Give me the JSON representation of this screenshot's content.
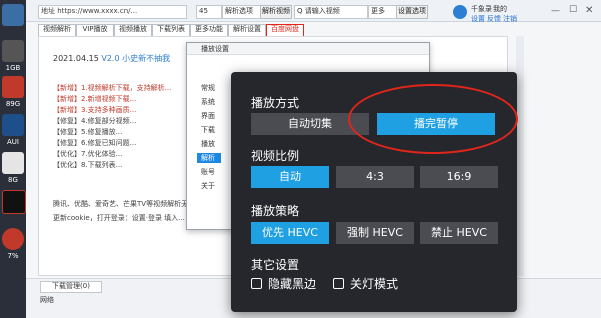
{
  "desktop": {
    "labels": [
      "1GB",
      "89G",
      "AUI",
      "8G",
      "7%"
    ]
  },
  "toolbar": {
    "url": "地址 https://www.xxxx.cn/...",
    "zoom": "45",
    "dropdown1": "解析选项",
    "button1": "解析视频",
    "search_placeholder": "Q 请输入视频",
    "select2": "更多",
    "button2": "设置选项"
  },
  "user": {
    "name": "千象录",
    "status": "我的",
    "links": [
      "设置",
      "反馈",
      "注销"
    ]
  },
  "tabs": [
    "视频解析",
    "VIP播放",
    "视频播放",
    "下载列表",
    "更多功能",
    "解析设置",
    "百度网盘"
  ],
  "doc": {
    "date_line": "2021.04.15",
    "version": "V2.0 小史新不抽我",
    "items": [
      "【新增】1.视频解析下载，支持解析...",
      "【新增】2.新增视频下载...",
      "【新增】3.支持多种画质...",
      "【修复】4.修复部分视频...",
      "【修复】5.修复播放...",
      "【修复】6.修复已知问题...",
      "【优化】7.优化体验...",
      "【优化】8.下载列表..."
    ],
    "line2": "腾讯、优酷、爱奇艺、芒果TV等视频解析无需登录...",
    "line3": "更新cookie，打开登录：设置·登录  填入..."
  },
  "dialog": {
    "title": "播放设置",
    "nav": [
      "常规",
      "系统",
      "界面",
      "下载",
      "播放",
      "解析",
      "账号",
      "关于"
    ],
    "selected": "播放"
  },
  "statusbar": {
    "downloads": "下载管理(0)",
    "net": "网络"
  },
  "panel": {
    "sections": [
      {
        "title": "播放方式",
        "options": [
          "自动切集",
          "播完暂停"
        ],
        "active": 1
      },
      {
        "title": "视频比例",
        "options": [
          "自动",
          "4:3",
          "16:9"
        ],
        "active": 0
      },
      {
        "title": "播放策略",
        "options": [
          "优先 HEVC",
          "强制 HEVC",
          "禁止 HEVC"
        ],
        "active": 0
      },
      {
        "title": "其它设置"
      }
    ],
    "checkboxes": [
      "隐藏黑边",
      "关灯模式"
    ]
  },
  "colors": {
    "panel_bg": "#25272c",
    "button_bg": "#4a4c52",
    "accent": "#1ea0e2",
    "annotation": "#e1251b"
  }
}
